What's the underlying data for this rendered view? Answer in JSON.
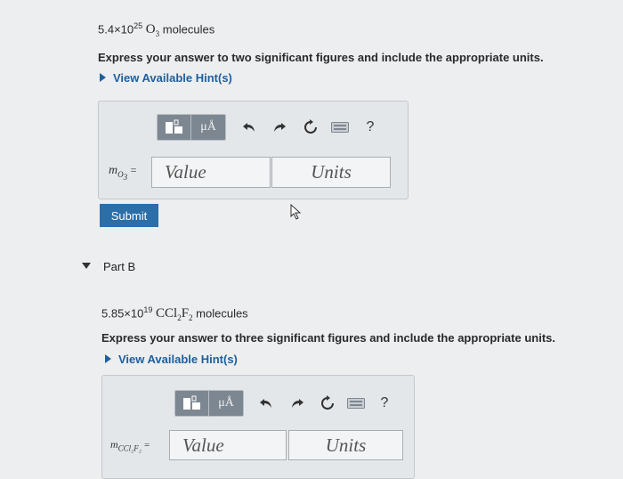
{
  "part_a": {
    "problem": {
      "coefficient": "5.4×10",
      "exponent": "25",
      "formula_main": "O",
      "formula_sub": "3",
      "suffix": "molecules"
    },
    "instruction": "Express your answer to two significant figures and include the appropriate units.",
    "hint_label": "View Available Hint(s)",
    "variable": {
      "base": "m",
      "sub": "O",
      "subsub": "3",
      "equals": "="
    },
    "value_placeholder": "Value",
    "units_placeholder": "Units",
    "submit_label": "Submit",
    "toolbar": {
      "mu_label": "μÅ",
      "help_label": "?"
    }
  },
  "part_b": {
    "title": "Part B",
    "problem": {
      "coefficient": "5.85×10",
      "exponent": "19",
      "f1": "CCl",
      "f1_sub": "2",
      "f2": "F",
      "f2_sub": "2",
      "suffix": "molecules"
    },
    "instruction": "Express your answer to three significant figures and include the appropriate units.",
    "hint_label": "View Available Hint(s)",
    "variable": {
      "label": "m",
      "sub": "CCl₂F₂",
      "equals": "="
    },
    "value_placeholder": "Value",
    "units_placeholder": "Units",
    "toolbar": {
      "mu_label": "μÅ",
      "help_label": "?"
    }
  },
  "colors": {
    "accent": "#2b6ea8",
    "link": "#1f5f9c",
    "background": "#eceef0"
  }
}
